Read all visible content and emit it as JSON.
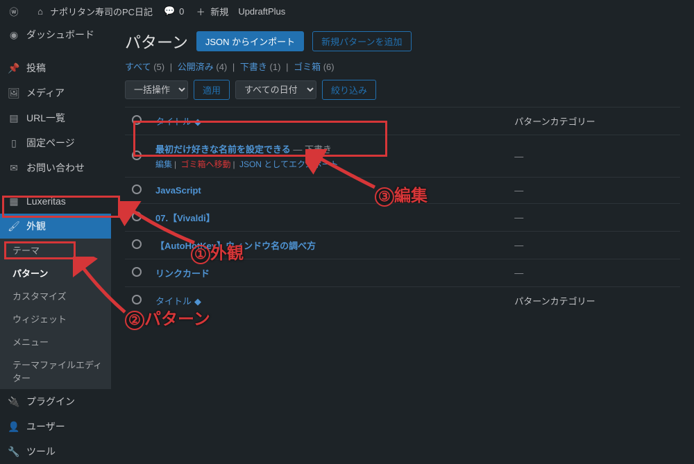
{
  "adminbar": {
    "site_name": "ナポリタン寿司のPC日記",
    "comments_count": "0",
    "new_label": "新規",
    "updraft_label": "UpdraftPlus"
  },
  "sidebar": {
    "dashboard": "ダッシュボード",
    "posts": "投稿",
    "media": "メディア",
    "url_list": "URL一覧",
    "pages": "固定ページ",
    "contact": "お問い合わせ",
    "luxeritas": "Luxeritas",
    "appearance": "外観",
    "appearance_sub": {
      "themes": "テーマ",
      "patterns": "パターン",
      "customize": "カスタマイズ",
      "widgets": "ウィジェット",
      "menus": "メニュー",
      "theme_file_editor": "テーマファイルエディター"
    },
    "plugins": "プラグイン",
    "users": "ユーザー",
    "tools": "ツール"
  },
  "page": {
    "title": "パターン",
    "import_btn": "JSON からインポート",
    "add_btn": "新規パターンを追加"
  },
  "filters": [
    {
      "label": "すべて",
      "count": "(5)"
    },
    {
      "label": "公開済み",
      "count": "(4)"
    },
    {
      "label": "下書き",
      "count": "(1)"
    },
    {
      "label": "ゴミ箱",
      "count": "(6)"
    }
  ],
  "toolbar": {
    "bulk_placeholder": "一括操作",
    "apply": "適用",
    "date_placeholder": "すべての日付",
    "filter": "絞り込み"
  },
  "table": {
    "col_title": "タイトル",
    "col_category": "パターンカテゴリー",
    "rows": [
      {
        "title": "最初だけ好きな名前を設定できる",
        "status_suffix": " — 下書き",
        "actions": {
          "edit": "編集",
          "trash": "ゴミ箱へ移動",
          "export": "JSON としてエクスポート"
        },
        "category": "—"
      },
      {
        "title": "JavaScript",
        "category": "—"
      },
      {
        "title": "07.【Vivaldi】",
        "category": "—"
      },
      {
        "title": "【AutoHotKey】ウィンドウ名の調べ方",
        "category": "—"
      },
      {
        "title": "リンクカード",
        "category": "—"
      }
    ]
  },
  "annotations": {
    "appearance": "外観",
    "patterns": "パターン",
    "edit": "編集",
    "num1": "①",
    "num2": "②",
    "num3": "③"
  }
}
